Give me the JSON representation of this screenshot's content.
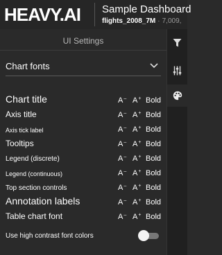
{
  "header": {
    "logo": "HEAVY.AI",
    "dashboard_title": "Sample Dashboard",
    "table_name": "flights_2008_7M",
    "separator": "·",
    "record_count": "7,009,"
  },
  "panel": {
    "title": "UI Settings",
    "section": {
      "label": "Chart fonts",
      "icon": "chevron-down-icon"
    },
    "rows": [
      {
        "label": "Chart title",
        "decrease": "A",
        "increase": "A",
        "bold": "Bold"
      },
      {
        "label": "Axis title",
        "decrease": "A",
        "increase": "A",
        "bold": "Bold"
      },
      {
        "label": "Axis tick label",
        "decrease": "A",
        "increase": "A",
        "bold": "Bold"
      },
      {
        "label": "Tooltips",
        "decrease": "A",
        "increase": "A",
        "bold": "Bold"
      },
      {
        "label": "Legend (discrete)",
        "decrease": "A",
        "increase": "A",
        "bold": "Bold"
      },
      {
        "label": "Legend (continuous)",
        "decrease": "A",
        "increase": "A",
        "bold": "Bold"
      },
      {
        "label": "Top section controls",
        "decrease": "A",
        "increase": "A",
        "bold": "Bold"
      },
      {
        "label": "Annotation labels",
        "decrease": "A",
        "increase": "A",
        "bold": "Bold"
      },
      {
        "label": "Table chart font",
        "decrease": "A",
        "increase": "A",
        "bold": "Bold"
      }
    ],
    "controls": {
      "decrease_mark": "–",
      "increase_mark": "+"
    },
    "high_contrast": {
      "label": "Use high contrast font colors",
      "enabled": false
    }
  },
  "rail": {
    "icons": [
      "filter-icon",
      "sliders-icon",
      "palette-icon"
    ],
    "active": "palette-icon"
  },
  "colors": {
    "background": "#2a2a2a",
    "header": "#262626",
    "rail": "#202020",
    "text": "#ffffff",
    "muted": "#b8b8b8",
    "toggle_track": "#777777"
  }
}
